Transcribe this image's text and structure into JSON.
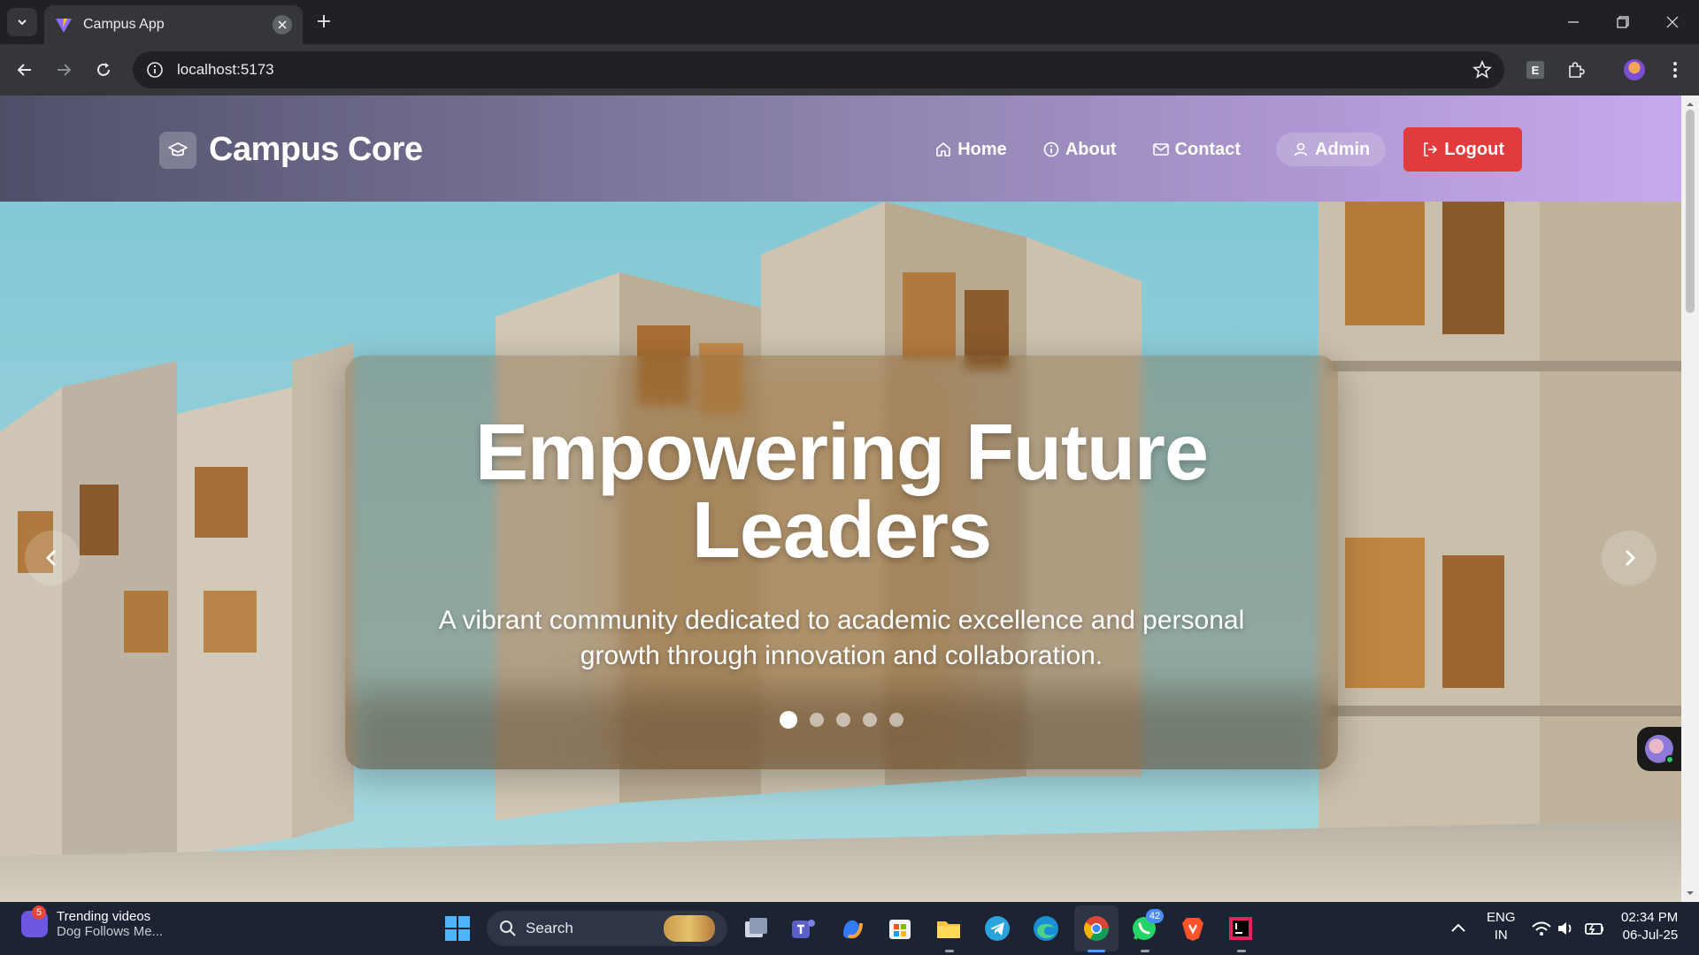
{
  "browser": {
    "tab_title": "Campus App",
    "url": "localhost:5173",
    "extension_letter": "E"
  },
  "app": {
    "brand": "Campus Core",
    "nav": {
      "home": "Home",
      "about": "About",
      "contact": "Contact",
      "admin": "Admin",
      "logout": "Logout"
    },
    "hero": {
      "title_line1": "Empowering Future",
      "title_line2": "Leaders",
      "subtitle": "A vibrant community dedicated to academic excellence and personal growth through innovation and collaboration.",
      "slide_count": 5,
      "active_slide": 1
    }
  },
  "taskbar": {
    "widget_title": "Trending videos",
    "widget_subtitle": "Dog Follows Me...",
    "widget_badge": "5",
    "search_label": "Search",
    "whatsapp_badge": "42",
    "lang_line1": "ENG",
    "lang_line2": "IN",
    "time": "02:34 PM",
    "date": "06-Jul-25"
  },
  "colors": {
    "nav_gradient_start": "#4e5068",
    "nav_gradient_end": "#c8a9ef",
    "logout": "#e23b3b"
  }
}
